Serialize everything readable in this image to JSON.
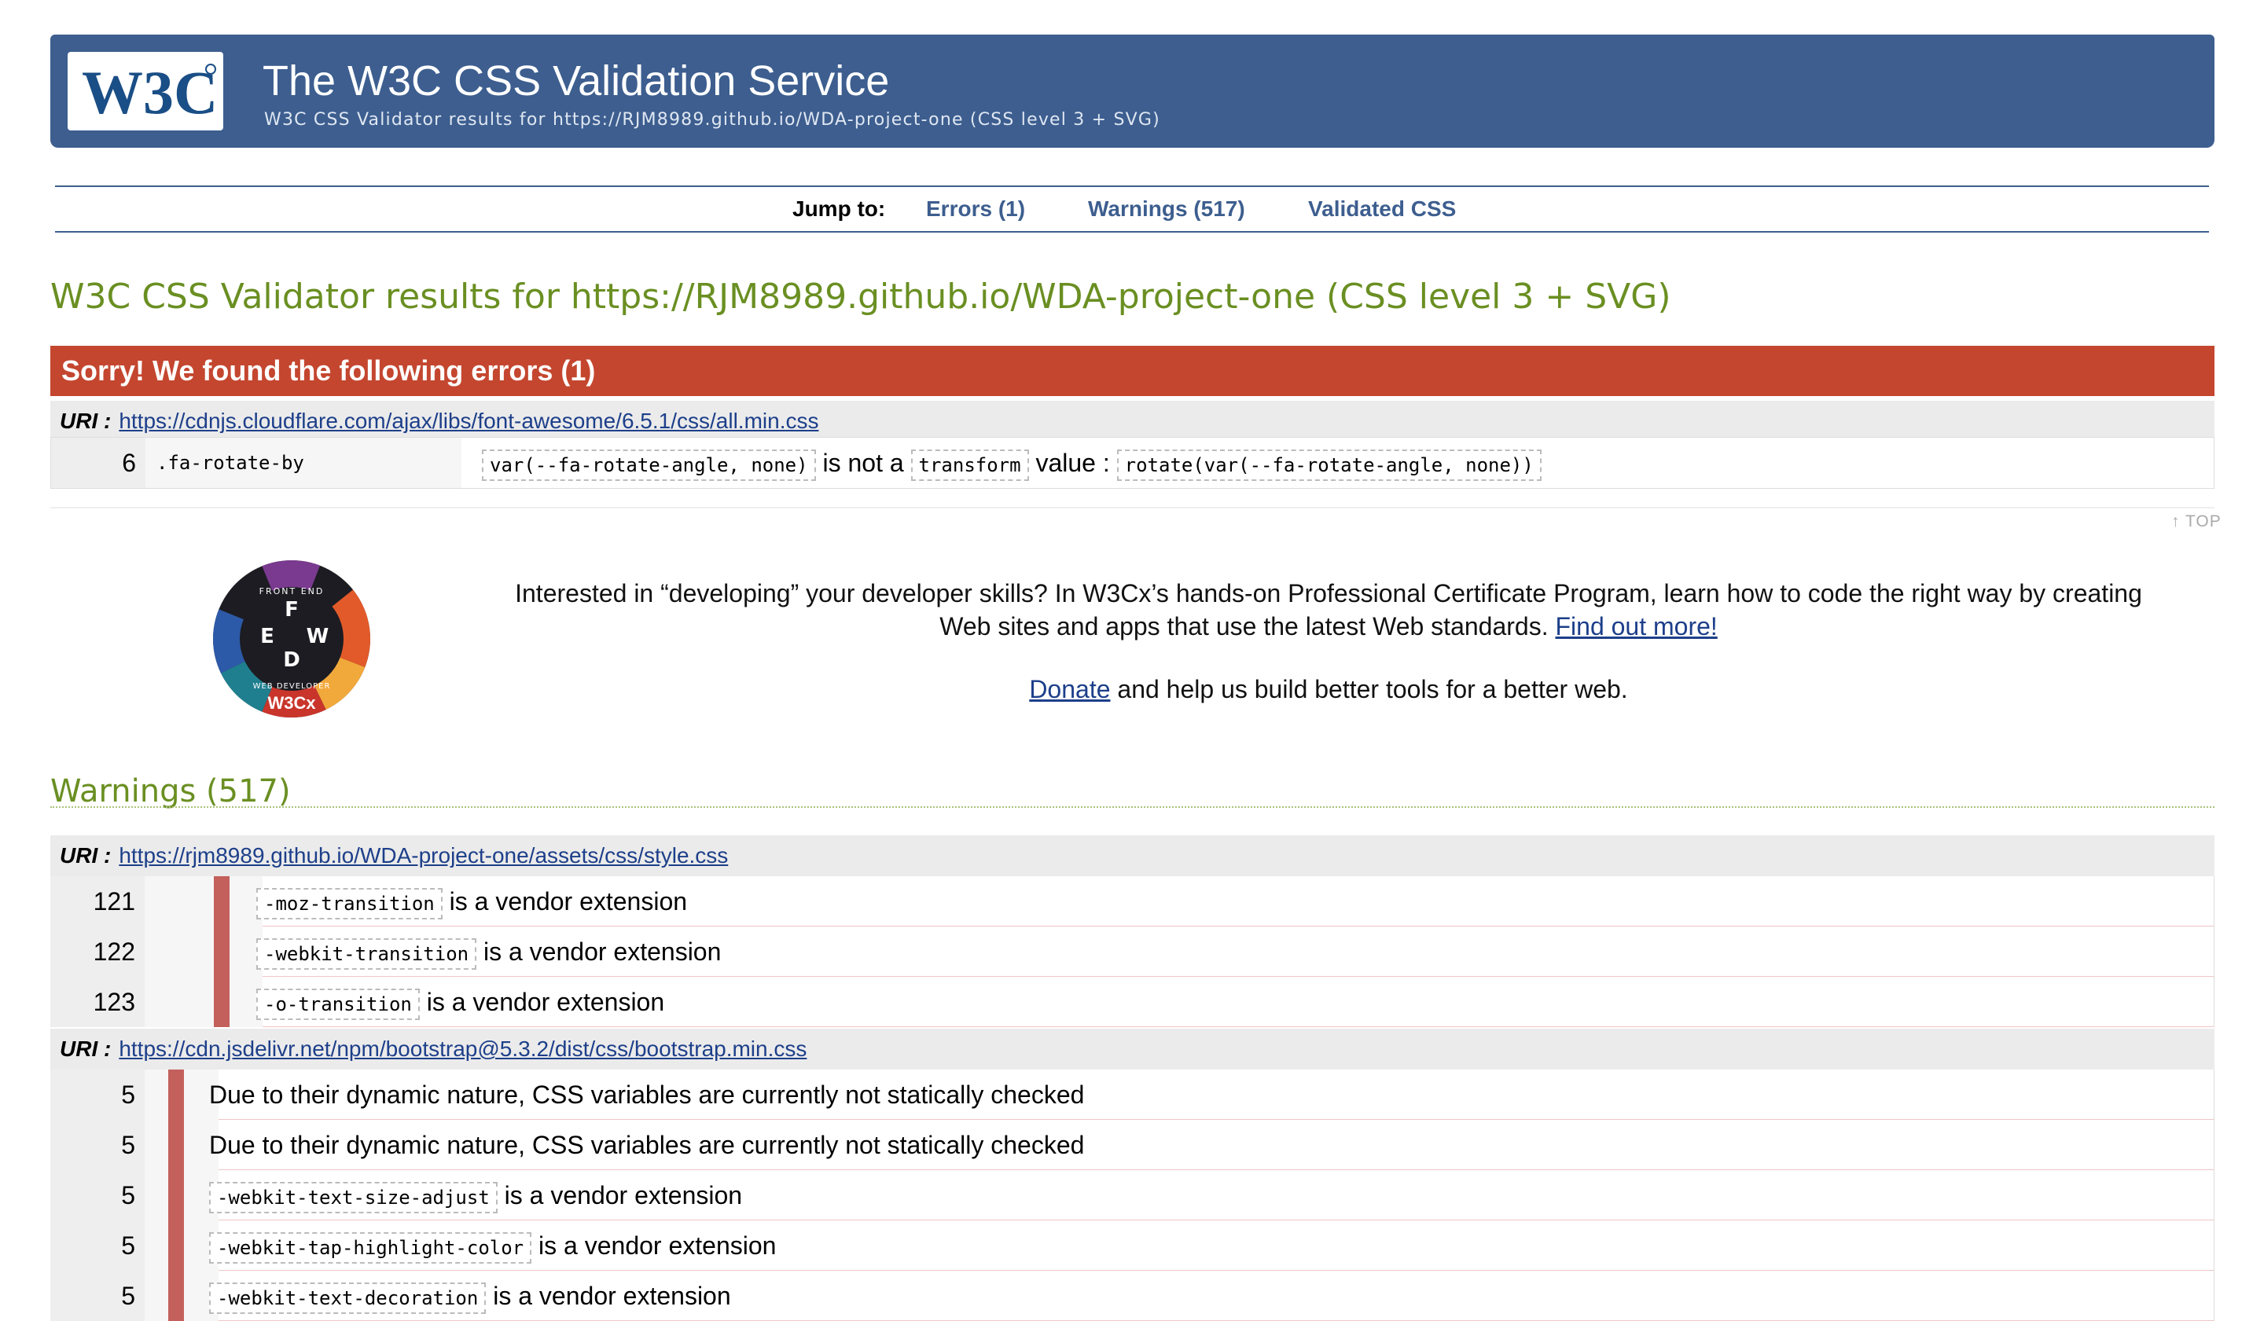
{
  "header": {
    "title": "The W3C CSS Validation Service",
    "subtitle": "W3C CSS Validator results for https://RJM8989.github.io/WDA-project-one (CSS level 3 + SVG)",
    "logo_text": "W3C"
  },
  "jump": {
    "label": "Jump to:",
    "links": [
      "Errors (1)",
      "Warnings (517)",
      "Validated CSS"
    ]
  },
  "results_heading": "W3C CSS Validator results for https://RJM8989.github.io/WDA-project-one (CSS level 3 + SVG)",
  "errors": {
    "title": "Sorry! We found the following errors (1)",
    "uri_label": "URI :",
    "uri": "https://cdnjs.cloudflare.com/ajax/libs/font-awesome/6.5.1/css/all.min.css",
    "row": {
      "line": "6",
      "context": ".fa-rotate-by",
      "token1": "var(--fa-rotate-angle, none)",
      "text1": "is not a",
      "token2": "transform",
      "text2": "value :",
      "token3": "rotate(var(--fa-rotate-angle, none))"
    }
  },
  "top_link": "↑ TOP",
  "promo": {
    "badge_letters": [
      "F",
      "E",
      "W",
      "D"
    ],
    "badge_ring_top": "FRONT END",
    "badge_ring_bottom": "WEB DEVELOPER",
    "badge_logo": "W3Cx",
    "text": "Interested in “developing” your developer skills? In W3Cx’s hands-on Professional Certificate Program, learn how to code the right way by creating Web sites and apps that use the latest Web standards.",
    "find_out": "Find out more!",
    "donate": "Donate",
    "donate_text": "and help us build better tools for a better web."
  },
  "warnings": {
    "title": "Warnings (517)",
    "uri_label": "URI :",
    "groups": [
      {
        "uri": "https://rjm8989.github.io/WDA-project-one/assets/css/style.css",
        "rows": [
          {
            "line": "121",
            "token": "-moz-transition",
            "message": "is a vendor extension"
          },
          {
            "line": "122",
            "token": "-webkit-transition",
            "message": "is a vendor extension"
          },
          {
            "line": "123",
            "token": "-o-transition",
            "message": "is a vendor extension"
          }
        ]
      },
      {
        "uri": "https://cdn.jsdelivr.net/npm/bootstrap@5.3.2/dist/css/bootstrap.min.css",
        "rows": [
          {
            "line": "5",
            "token": "",
            "message": "Due to their dynamic nature, CSS variables are currently not statically checked"
          },
          {
            "line": "5",
            "token": "",
            "message": "Due to their dynamic nature, CSS variables are currently not statically checked"
          },
          {
            "line": "5",
            "token": "-webkit-text-size-adjust",
            "message": "is a vendor extension"
          },
          {
            "line": "5",
            "token": "-webkit-tap-highlight-color",
            "message": "is a vendor extension"
          },
          {
            "line": "5",
            "token": "-webkit-text-decoration",
            "message": "is a vendor extension"
          }
        ]
      }
    ]
  },
  "colors": {
    "banner": "#3d5e8f",
    "heading_green": "#6a8f22",
    "error_red": "#c4462f",
    "warn_bar": "#c4605b",
    "link": "#1d3f8a"
  }
}
